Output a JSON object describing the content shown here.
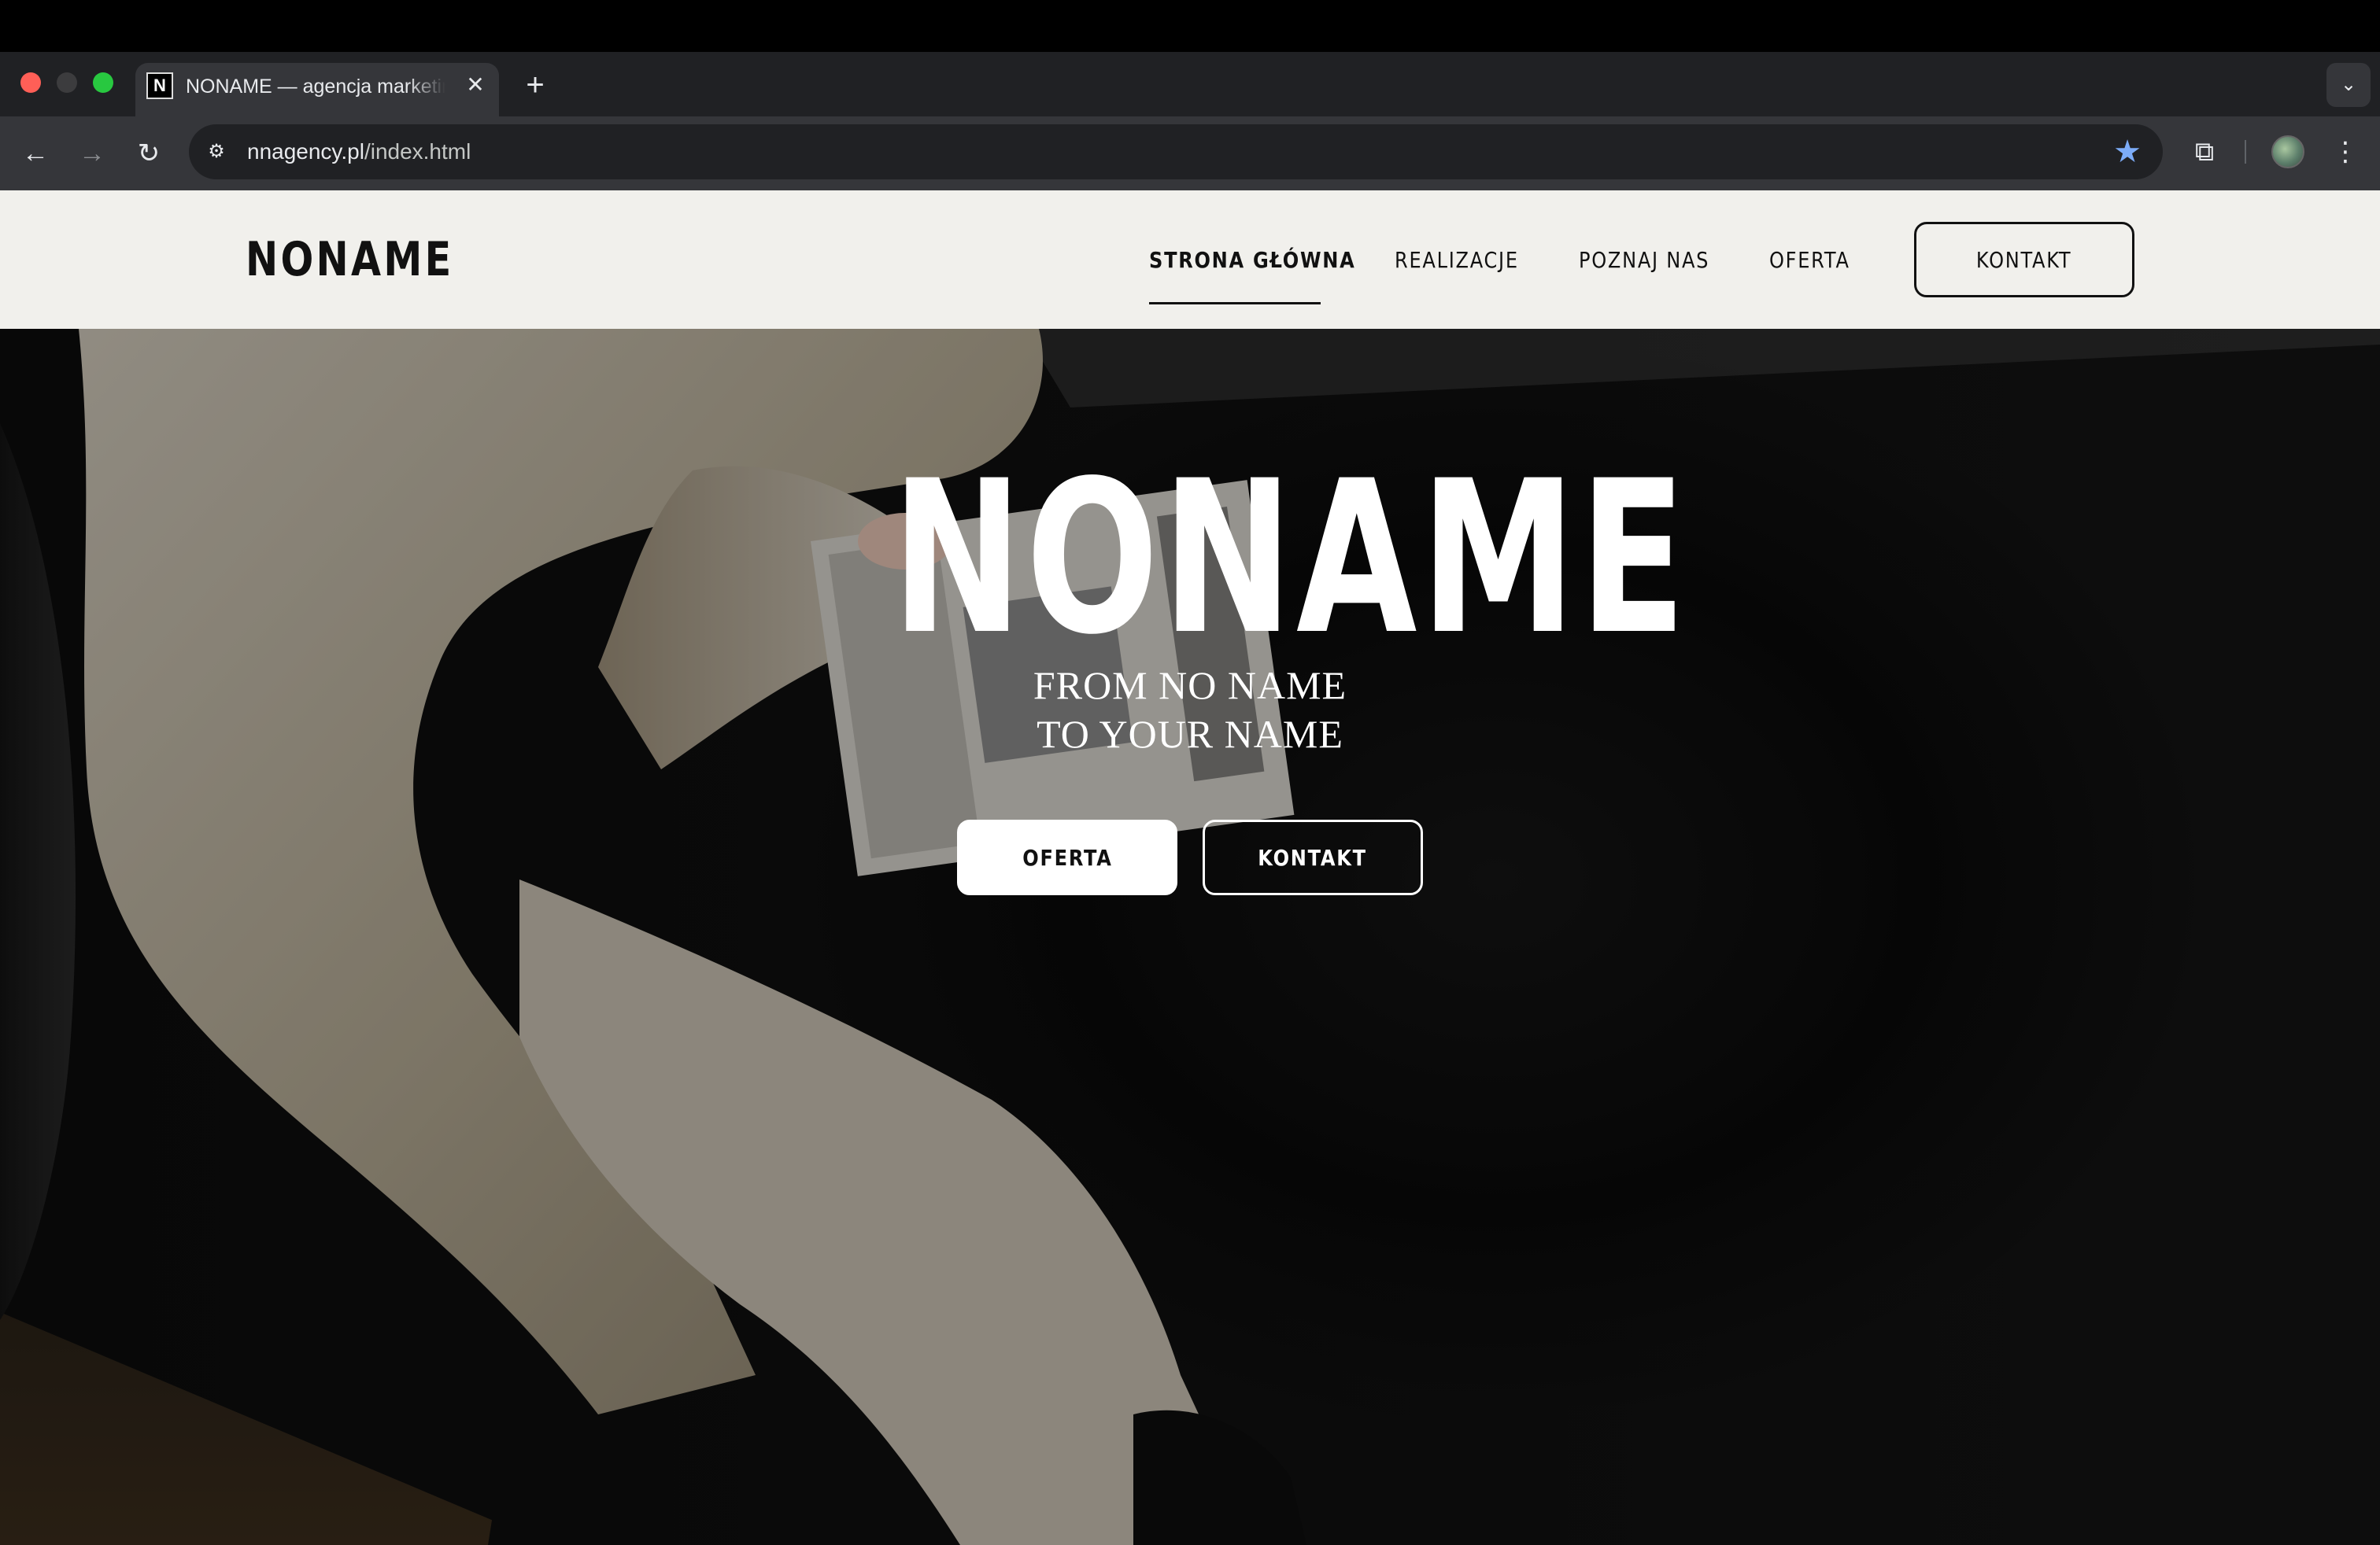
{
  "browser": {
    "tab": {
      "favicon_letter": "N",
      "title": "NONAME — agencja marketingowa"
    },
    "new_tab_label": "+",
    "url": {
      "host": "nnagency.pl",
      "path": "/index.html"
    },
    "colors": {
      "tab_bar": "#202124",
      "toolbar": "#35363a",
      "bookmark_star": "#7cacf8"
    }
  },
  "site": {
    "logo": "NONAME",
    "nav": {
      "home": "STRONA GŁÓWNA",
      "portfolio": "REALIZACJE",
      "about": "POZNAJ NAS",
      "offer": "OFERTA",
      "contact": "KONTAKT"
    },
    "active_nav": "home",
    "colors": {
      "header_bg": "#f1f0ec",
      "text": "#111111"
    }
  },
  "hero": {
    "title": "NONAME",
    "subtitle_line1": "FROM NO NAME",
    "subtitle_line2": "TO YOUR NAME",
    "primary_button": "OFERTA",
    "secondary_button": "KONTAKT"
  }
}
